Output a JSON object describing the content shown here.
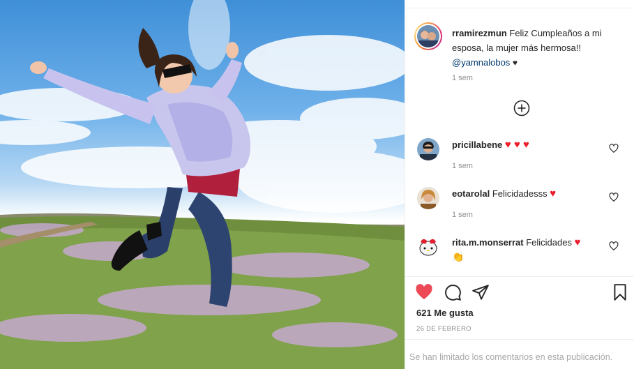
{
  "post": {
    "author": "rramirezmun",
    "caption_text": "Feliz Cumpleaños a mi esposa, la mujer más hermosa!!",
    "mention": "@yamnalobos",
    "caption_emoji": "♥",
    "time": "1 sem"
  },
  "load_more_icon": "plus-circle-icon",
  "comments": [
    {
      "username": "pricillabene",
      "text": "",
      "emoji": "♥ ♥ ♥",
      "time": "1 sem"
    },
    {
      "username": "eotarolal",
      "text": "Felicidadesss",
      "emoji": "♥",
      "time": "1 sem"
    },
    {
      "username": "rita.m.monserrat",
      "text": "Felicidades",
      "emoji": "♥",
      "emoji2": "👏"
    }
  ],
  "actions": {
    "like_icon": "heart-filled-icon",
    "comment_icon": "comment-icon",
    "share_icon": "paper-plane-icon",
    "save_icon": "bookmark-icon"
  },
  "likes_text": "621 Me gusta",
  "date_text": "26 DE FEBRERO",
  "comments_limited_text": "Se han limitado los comentarios en esta publicación.",
  "colors": {
    "like_red": "#ed4956",
    "mention_blue": "#00376b",
    "muted_gray": "#8e8e8e"
  }
}
